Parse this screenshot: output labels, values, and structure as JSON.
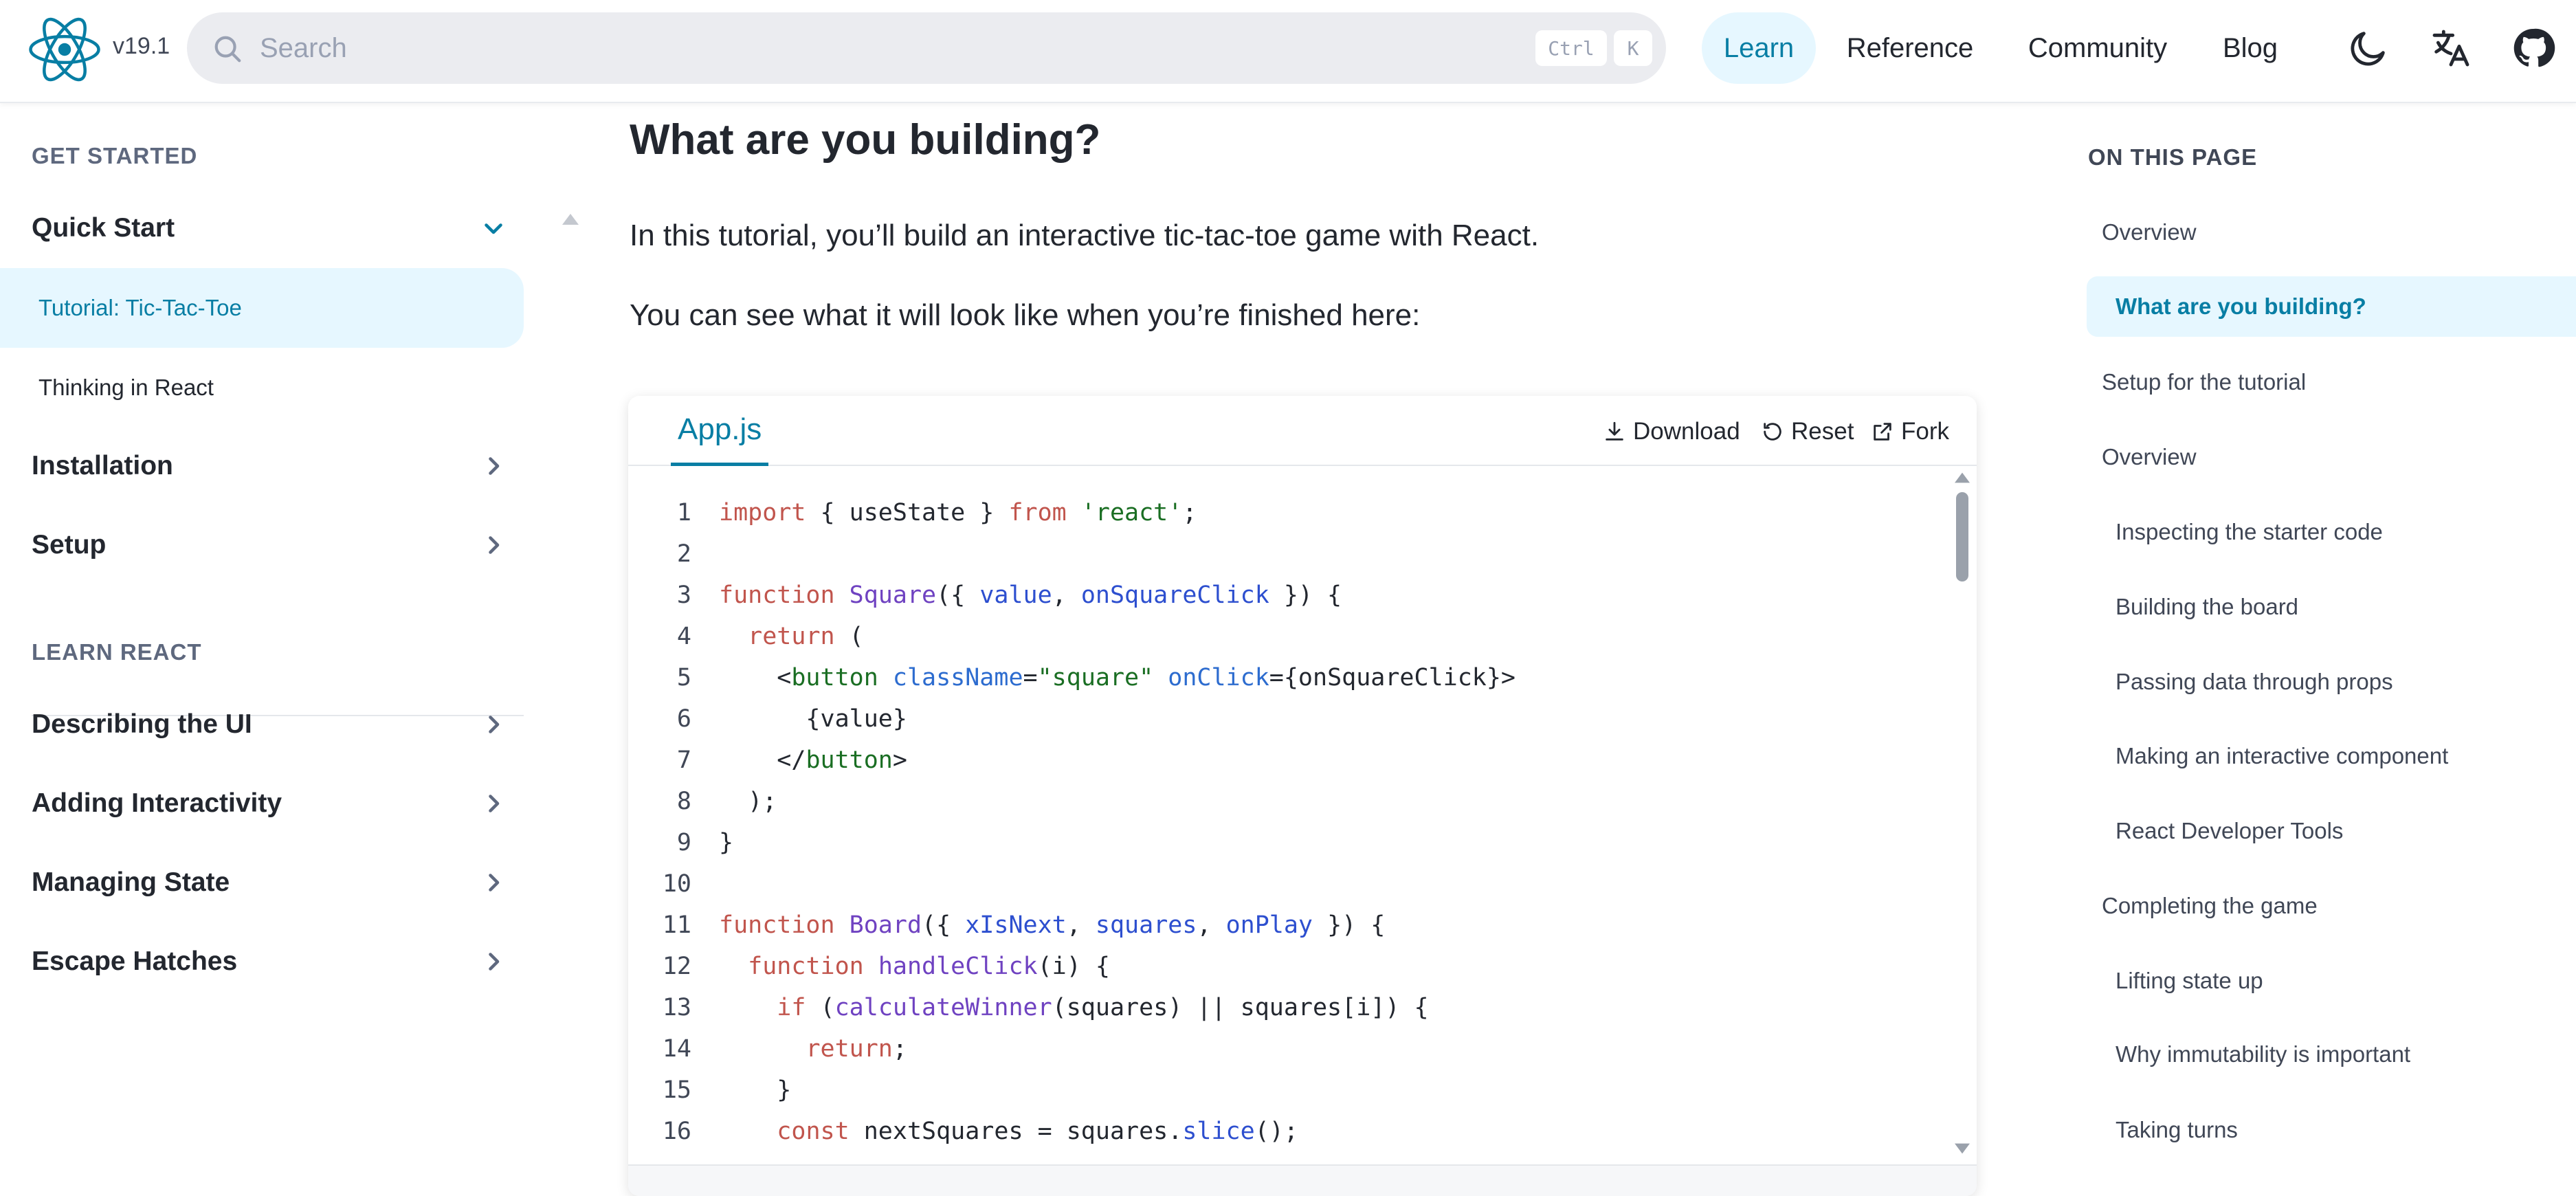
{
  "header": {
    "version": "v19.1",
    "search_placeholder": "Search",
    "kbd_ctrl": "Ctrl",
    "kbd_k": "K",
    "nav": [
      "Learn",
      "Reference",
      "Community",
      "Blog"
    ],
    "accent_color": "#087ea4",
    "icons": [
      "react-logo-icon",
      "search-icon",
      "moon-icon",
      "translate-icon",
      "github-icon"
    ]
  },
  "sidebar": {
    "section_get_started": "GET STARTED",
    "quick_start": "Quick Start",
    "tutorial": "Tutorial: Tic-Tac-Toe",
    "thinking": "Thinking in React",
    "installation": "Installation",
    "setup": "Setup",
    "section_learn": "LEARN REACT",
    "describing": "Describing the UI",
    "adding": "Adding Interactivity",
    "managing": "Managing State",
    "escape": "Escape Hatches"
  },
  "main": {
    "title": "What are you building?",
    "para1": "In this tutorial, you’ll build an interactive tic-tac-toe game with React.",
    "para2": "You can see what it will look like when you’re finished here:"
  },
  "sandpack": {
    "tab": "App.js",
    "download": "Download",
    "reset": "Reset",
    "fork": "Fork",
    "code_lines": [
      "import { useState } from 'react';",
      "",
      "function Square({ value, onSquareClick }) {",
      "  return (",
      "    <button className=\"square\" onClick={onSquareClick}>",
      "      {value}",
      "    </button>",
      "  );",
      "}",
      "",
      "function Board({ xIsNext, squares, onPlay }) {",
      "  function handleClick(i) {",
      "    if (calculateWinner(squares) || squares[i]) {",
      "      return;",
      "    }",
      "    const nextSquares = squares.slice();"
    ]
  },
  "toc": {
    "heading": "ON THIS PAGE",
    "items": [
      "Overview",
      "What are you building?",
      "Setup for the tutorial",
      "Overview",
      "Inspecting the starter code",
      "Building the board",
      "Passing data through props",
      "Making an interactive component",
      "React Developer Tools",
      "Completing the game",
      "Lifting state up",
      "Why immutability is important",
      "Taking turns"
    ]
  }
}
